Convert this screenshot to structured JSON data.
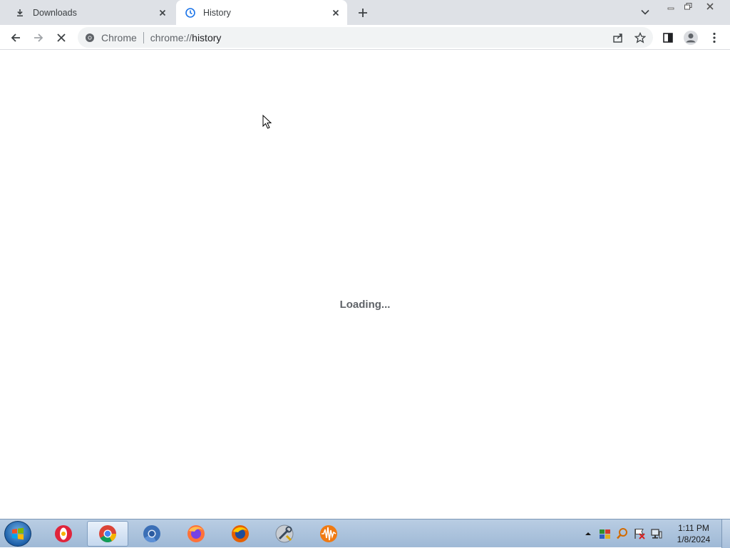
{
  "tabs": [
    {
      "title": "Downloads",
      "icon": "download-icon",
      "active": false
    },
    {
      "title": "History",
      "icon": "history-icon",
      "active": true
    }
  ],
  "toolbar": {
    "site_label": "Chrome",
    "url_prefix": "chrome://",
    "url_host": "history"
  },
  "content": {
    "loading_text": "Loading..."
  },
  "taskbar": {
    "apps": [
      {
        "name": "opera",
        "icon": "opera-icon"
      },
      {
        "name": "chrome",
        "icon": "chrome-icon",
        "active": true
      },
      {
        "name": "chromium",
        "icon": "chromium-icon"
      },
      {
        "name": "firefox",
        "icon": "firefox-icon"
      },
      {
        "name": "firefox-alt",
        "icon": "firefox-icon"
      },
      {
        "name": "tool",
        "icon": "tool-icon"
      },
      {
        "name": "audio",
        "icon": "audio-wave-icon"
      }
    ],
    "clock_time": "1:11 PM",
    "clock_date": "1/8/2024"
  },
  "colors": {
    "tabstrip_bg": "#dee1e6",
    "omnibox_bg": "#f1f3f4",
    "accent_blue": "#1a73e8",
    "text_gray": "#5f6368"
  }
}
